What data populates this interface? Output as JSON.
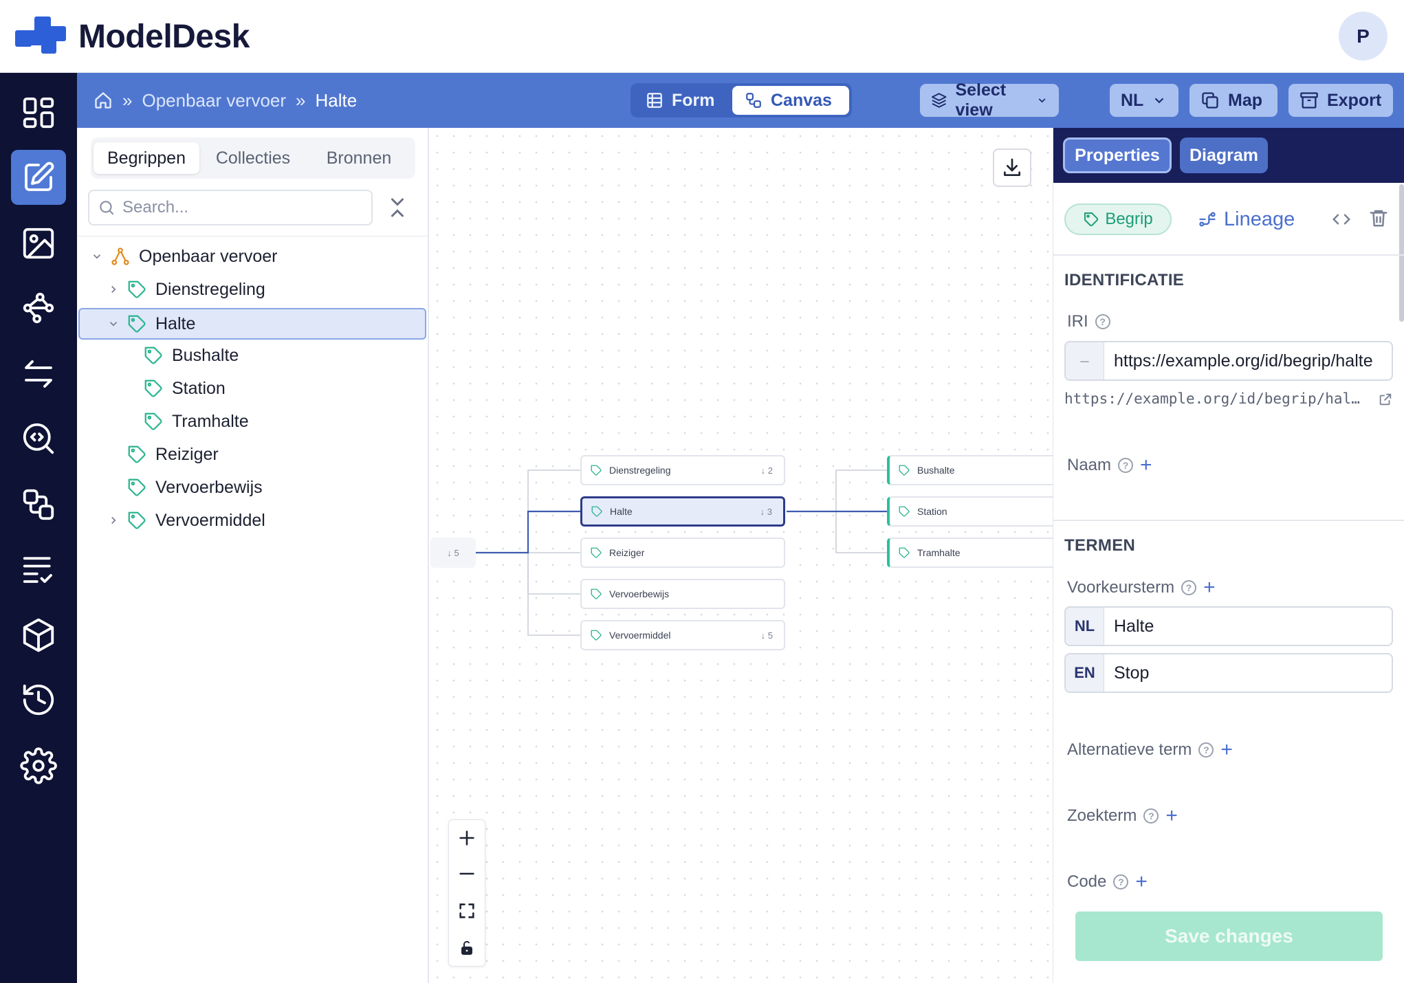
{
  "app": {
    "brand": "ModelDesk",
    "user_initial": "P"
  },
  "breadcrumb": {
    "items": [
      "Openbaar vervoer",
      "Halte"
    ],
    "separator": "»"
  },
  "toolbar": {
    "modes": [
      "Form",
      "Canvas"
    ],
    "active_mode": "Canvas",
    "select_view": "Select view",
    "language": "NL",
    "map": "Map",
    "export": "Export"
  },
  "left_panel": {
    "tabs": [
      "Begrippen",
      "Collecties",
      "Bronnen"
    ],
    "active_tab": "Begrippen",
    "search": {
      "placeholder": "Search...",
      "value": ""
    },
    "tree": [
      {
        "label": "Openbaar vervoer",
        "level": 0,
        "expanded": true,
        "icon": "hierarchy-icon"
      },
      {
        "label": "Dienstregeling",
        "level": 1,
        "expanded": false,
        "icon": "tag-icon"
      },
      {
        "label": "Halte",
        "level": 1,
        "expanded": true,
        "selected": true,
        "icon": "tag-icon"
      },
      {
        "label": "Bushalte",
        "level": 2,
        "icon": "tag-icon"
      },
      {
        "label": "Station",
        "level": 2,
        "icon": "tag-icon"
      },
      {
        "label": "Tramhalte",
        "level": 2,
        "icon": "tag-icon"
      },
      {
        "label": "Reiziger",
        "level": 1,
        "icon": "tag-icon"
      },
      {
        "label": "Vervoerbewijs",
        "level": 1,
        "icon": "tag-icon"
      },
      {
        "label": "Vervoermiddel",
        "level": 1,
        "expanded": false,
        "icon": "tag-icon"
      }
    ]
  },
  "canvas": {
    "root_count": "↓ 5",
    "nodes": [
      {
        "label": "Dienstregeling",
        "count": "↓ 2"
      },
      {
        "label": "Halte",
        "count": "↓ 3",
        "selected": true
      },
      {
        "label": "Reiziger",
        "count": ""
      },
      {
        "label": "Vervoerbewijs",
        "count": ""
      },
      {
        "label": "Vervoermiddel",
        "count": "↓ 5"
      }
    ],
    "children": [
      {
        "label": "Bushalte"
      },
      {
        "label": "Station"
      },
      {
        "label": "Tramhalte"
      }
    ],
    "zoom_controls": [
      "zoom-in-icon",
      "zoom-out-icon",
      "fit-view-icon",
      "lock-icon"
    ]
  },
  "right_panel": {
    "tabs": [
      "Properties",
      "Diagram"
    ],
    "active_tab": "Properties",
    "type_chip": "Begrip",
    "lineage": "Lineage",
    "sections": {
      "identificatie": "IDENTIFICATIE",
      "termen": "TERMEN"
    },
    "iri": {
      "label": "IRI",
      "prefix": "–",
      "value": "https://example.org/id/begrip/halte",
      "display": "https://example.org/id/begrip/hal…"
    },
    "naam": {
      "label": "Naam"
    },
    "voorkeursterm": {
      "label": "Voorkeursterm",
      "values": [
        {
          "lang": "NL",
          "value": "Halte"
        },
        {
          "lang": "EN",
          "value": "Stop"
        }
      ]
    },
    "alternatieve_term": {
      "label": "Alternatieve term"
    },
    "zoekterm": {
      "label": "Zoekterm"
    },
    "code": {
      "label": "Code"
    },
    "save": "Save changes"
  },
  "colors": {
    "toolbar": "#5077d0",
    "rail": "#0e1235",
    "accent_green": "#2bbf9a",
    "selected_node_border": "#2d3b8a",
    "save_disabled": "#a7e7cf"
  }
}
